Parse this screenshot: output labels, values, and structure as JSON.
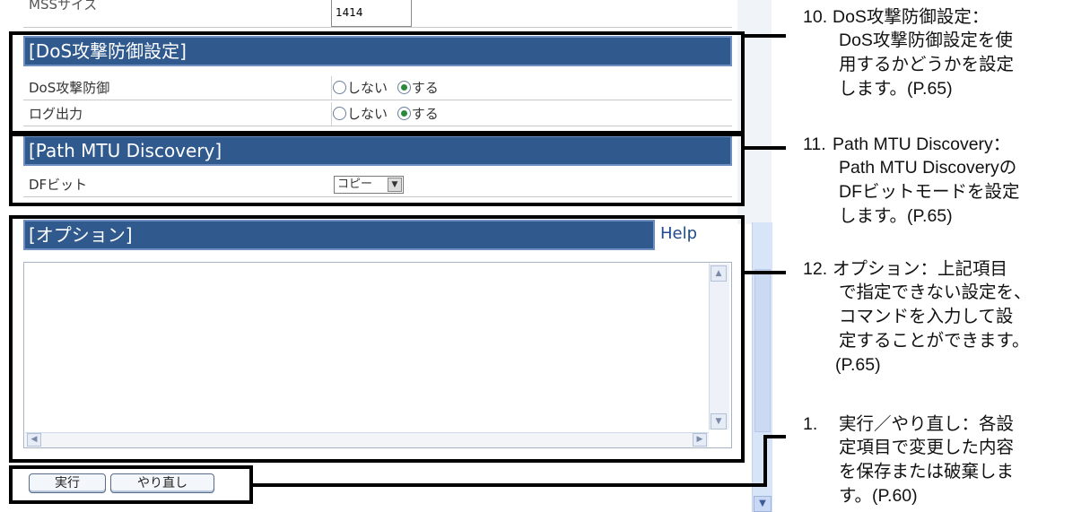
{
  "mss": {
    "label": "MSSサイズ",
    "value": "1414"
  },
  "dos": {
    "header": "[DoS攻撃防御設定]",
    "rows": [
      {
        "label": "DoS攻撃防御",
        "opt_off": "しない",
        "opt_on": "する",
        "selected": "on"
      },
      {
        "label": "ログ出力",
        "opt_off": "しない",
        "opt_on": "する",
        "selected": "on"
      }
    ]
  },
  "pmtu": {
    "header": "[Path MTU Discovery]",
    "df_label": "DFビット",
    "df_value": "コピー"
  },
  "options": {
    "header": "[オプション]",
    "help": "Help",
    "text": ""
  },
  "buttons": {
    "execute": "実行",
    "redo": "やり直し"
  },
  "annotations": [
    {
      "num": "10.",
      "lines": [
        "DoS攻撃防御設定：",
        "DoS攻撃防御設定を使",
        "用するかどうかを設定",
        "します。(P.65)"
      ]
    },
    {
      "num": "11.",
      "lines": [
        "Path MTU Discovery：",
        "Path MTU Discoveryの",
        "DFビットモードを設定",
        "します。(P.65)"
      ]
    },
    {
      "num": "12.",
      "lines": [
        "オプション：上記項目",
        "で指定できない設定を、",
        "コマンドを入力して設",
        "定することができます。",
        "(P.65)"
      ]
    },
    {
      "num": "1.",
      "lines": [
        "実行／やり直し：各設",
        "定項目で変更した内容",
        "を保存または破棄しま",
        "す。(P.60)"
      ]
    }
  ]
}
